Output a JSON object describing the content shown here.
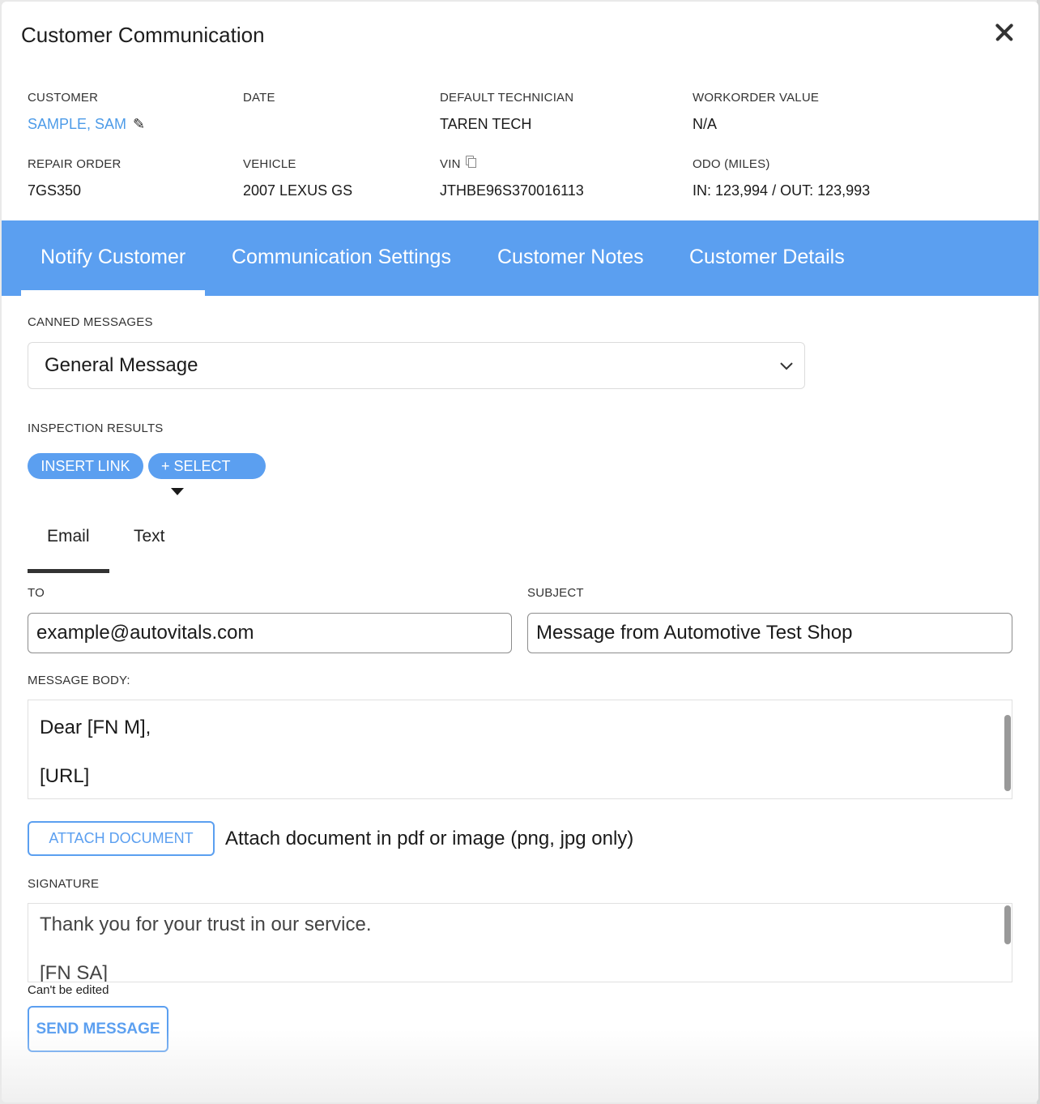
{
  "modal": {
    "title": "Customer Communication"
  },
  "info": {
    "customer": {
      "label": "CUSTOMER",
      "value": "SAMPLE, SAM"
    },
    "date": {
      "label": "DATE",
      "value": ""
    },
    "technician": {
      "label": "DEFAULT TECHNICIAN",
      "value": "TAREN TECH"
    },
    "workorder": {
      "label": "WORKORDER VALUE",
      "value": "N/A"
    },
    "repair_order": {
      "label": "REPAIR ORDER",
      "value": "7GS350"
    },
    "vehicle": {
      "label": "VEHICLE",
      "value": "2007 LEXUS GS"
    },
    "vin": {
      "label": "VIN",
      "value": "JTHBE96S370016113"
    },
    "odo": {
      "label": "ODO (MILES)",
      "value": "IN: 123,994 / OUT: 123,993"
    }
  },
  "tabs": [
    {
      "label": "Notify Customer",
      "active": true
    },
    {
      "label": "Communication Settings",
      "active": false
    },
    {
      "label": "Customer Notes",
      "active": false
    },
    {
      "label": "Customer Details",
      "active": false
    }
  ],
  "canned": {
    "label": "CANNED MESSAGES",
    "selected": "General Message"
  },
  "inspection": {
    "label": "INSPECTION RESULTS",
    "insert_link": "INSERT LINK",
    "select": "+ SELECT"
  },
  "subtabs": [
    {
      "label": "Email",
      "active": true
    },
    {
      "label": "Text",
      "active": false
    }
  ],
  "email": {
    "to_label": "TO",
    "to_value": "example@autovitals.com",
    "subject_label": "SUBJECT",
    "subject_value": "Message from Automotive Test Shop",
    "body_label": "MESSAGE BODY:",
    "body_lines": [
      "Dear [FN M],",
      "[URL]"
    ]
  },
  "attach": {
    "button": "ATTACH DOCUMENT",
    "hint": "Attach document in pdf or image (png, jpg only)"
  },
  "signature": {
    "label": "SIGNATURE",
    "lines": [
      "Thank you for your trust in our service.",
      "[FN SA]"
    ],
    "note": "Can't be edited"
  },
  "send_button": "SEND MESSAGE",
  "colors": {
    "accent": "#5b9ff0",
    "link": "#4d9be8"
  }
}
